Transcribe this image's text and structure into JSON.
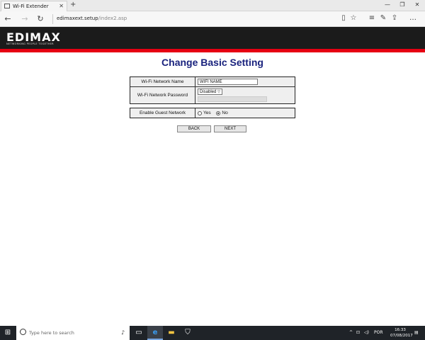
{
  "browser": {
    "tab_title": "Wi-Fi Extender",
    "url_host": "edimaxext.setup",
    "url_path": "/index2.asp"
  },
  "header": {
    "logo": "EDIMAX",
    "tagline": "NETWORKING PEOPLE TOGETHER"
  },
  "page": {
    "title": "Change Basic Setting",
    "wifi_name_label": "Wi-Fi Network Name",
    "wifi_name_value": "WIFI NAME",
    "wifi_password_label": "Wi-Fi Network Password",
    "wifi_password_mode": "Disabled",
    "guest_label": "Enable Guest Network",
    "guest_yes": "Yes",
    "guest_no": "No",
    "back_button": "BACK",
    "next_button": "NEXT"
  },
  "taskbar": {
    "search_placeholder": "Type here to search",
    "language": "POR",
    "time": "16:33",
    "date": "07/08/2017"
  }
}
